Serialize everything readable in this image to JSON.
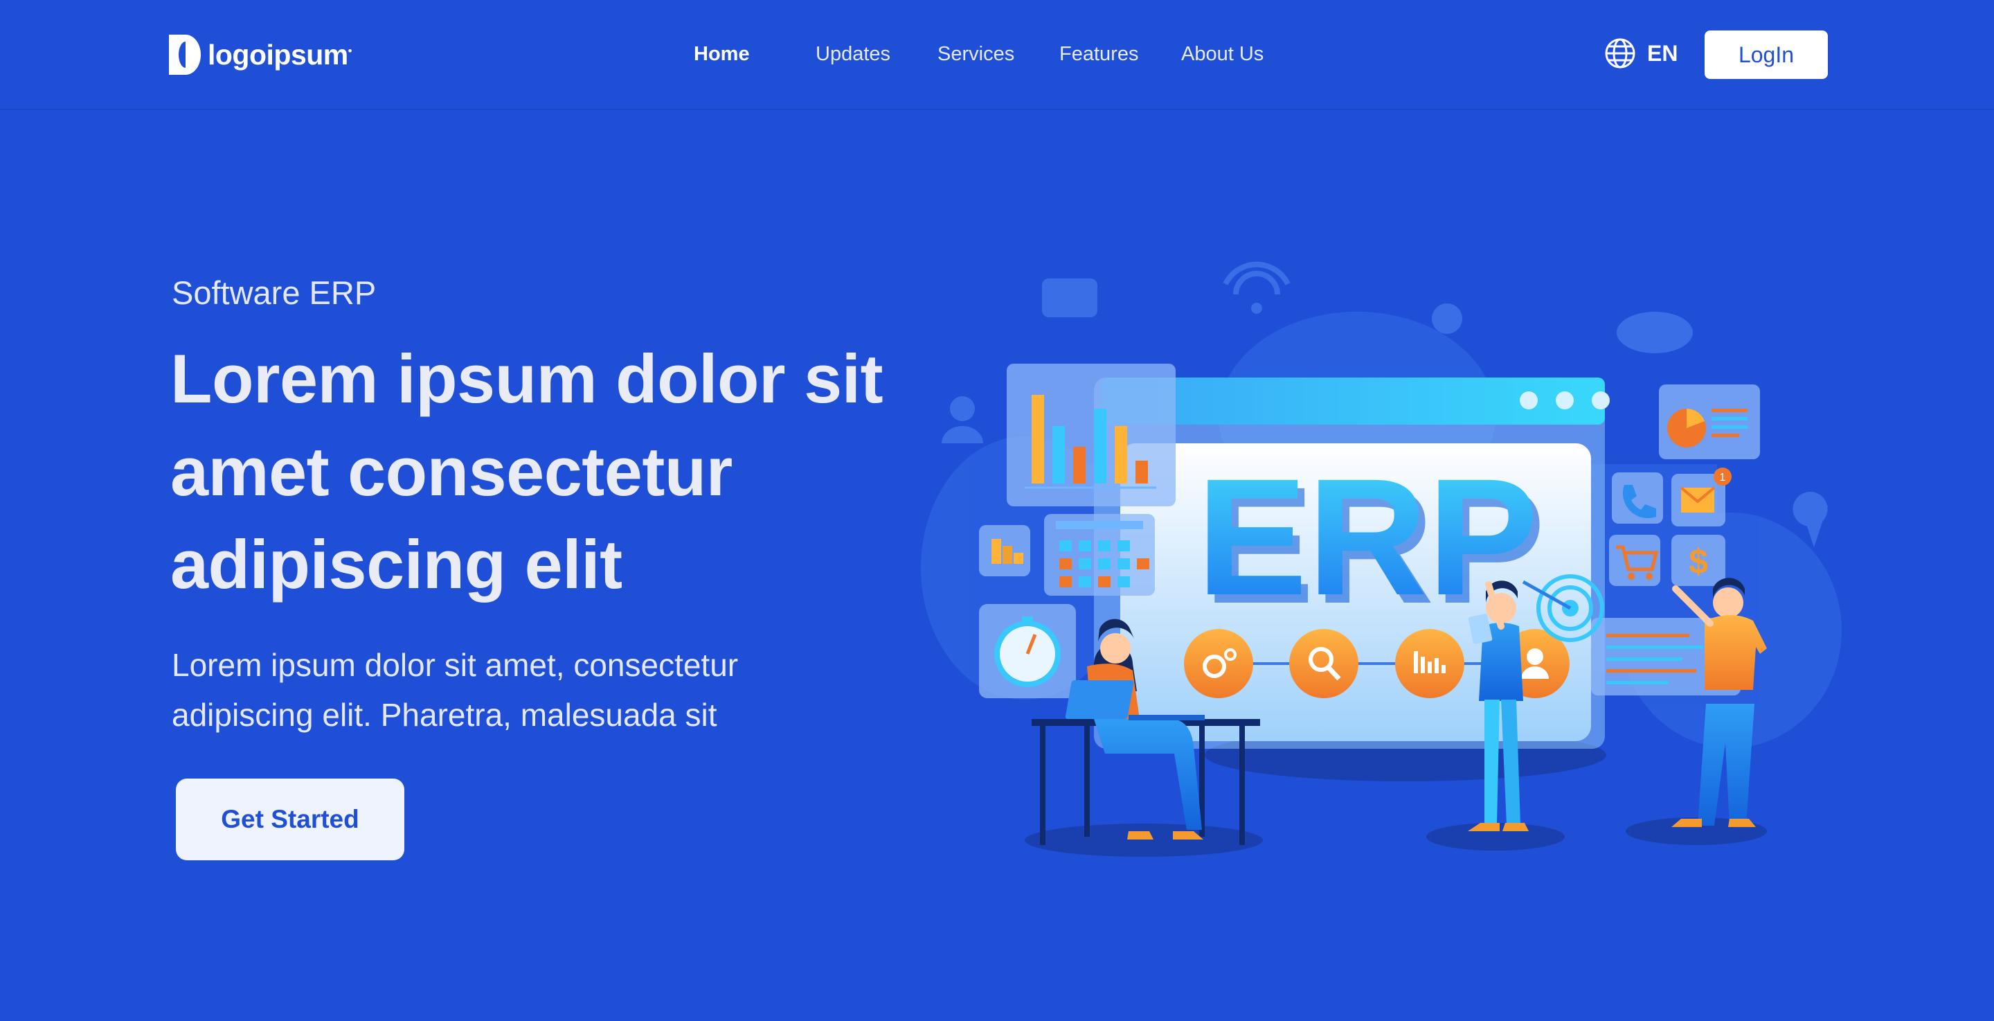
{
  "nav": {
    "logo_text": "logoipsum",
    "links": [
      {
        "label": "Home",
        "active": true
      },
      {
        "label": "Updates"
      },
      {
        "label": "Services"
      },
      {
        "label": "Features"
      },
      {
        "label": "About Us"
      }
    ],
    "language": "EN",
    "login_label": "LogIn"
  },
  "hero": {
    "eyebrow": "Software ERP",
    "headline_lines": [
      "Lorem ipsum dolor sit",
      "amet consectetur",
      "adipiscing elit"
    ],
    "subtext_lines": [
      "Lorem ipsum dolor sit amet, consectetur",
      "adipiscing elit. Pharetra, malesuada sit"
    ],
    "cta_label": "Get Started"
  },
  "illustration": {
    "screen_text": "ERP",
    "notification_count": "1",
    "dollar_symbol": "$"
  },
  "colors": {
    "background": "#1f4fd7",
    "accent_orange": "#f59a2f",
    "accent_cyan": "#38d5fb",
    "button_bg": "#ffffff"
  }
}
